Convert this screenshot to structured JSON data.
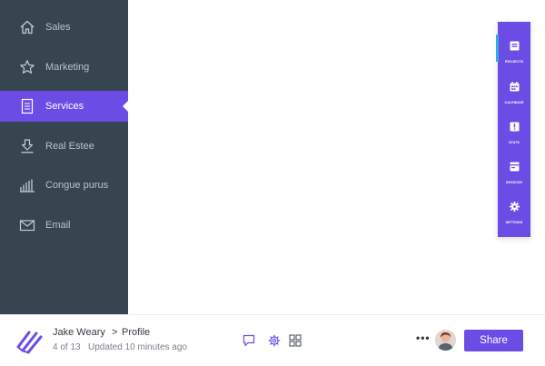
{
  "sidebar": {
    "items": [
      {
        "label": "Sales",
        "icon": "home-icon"
      },
      {
        "label": "Marketing",
        "icon": "star-icon"
      },
      {
        "label": "Services",
        "icon": "document-icon",
        "active": true
      },
      {
        "label": "Real Estee",
        "icon": "download-icon"
      },
      {
        "label": "Congue purus",
        "icon": "bar-chart-icon"
      },
      {
        "label": "Email",
        "icon": "mail-icon"
      }
    ]
  },
  "rail": {
    "items": [
      {
        "label": "PROJECTS",
        "icon": "projects-icon"
      },
      {
        "label": "CALENDAR",
        "icon": "calendar-icon"
      },
      {
        "label": "STATS",
        "icon": "stats-icon"
      },
      {
        "label": "INVOICES",
        "icon": "invoices-icon"
      },
      {
        "label": "SETTINGS",
        "icon": "settings-icon"
      }
    ]
  },
  "footer": {
    "user_name": "Jake Weary",
    "separator": ">",
    "page": "Profile",
    "count": "4 of 13",
    "updated": "Updated 10 minutes ago",
    "more": "•••",
    "share_label": "Share"
  },
  "colors": {
    "sidebar_bg": "#36454f",
    "accent": "#6b4de6",
    "rail_marker": "#35a9e8",
    "text_muted": "#b9c3cb"
  }
}
